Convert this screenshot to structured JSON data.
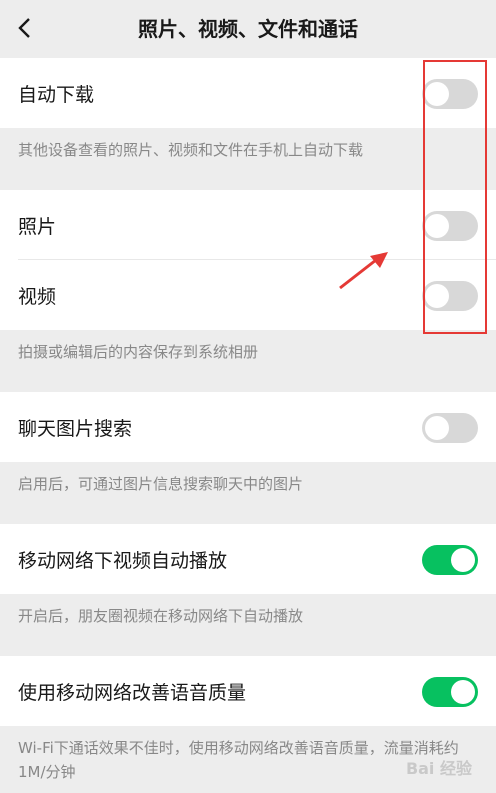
{
  "header": {
    "back_icon": "chevron-left-icon",
    "title": "照片、视频、文件和通话"
  },
  "settings": [
    {
      "label": "自动下载",
      "on": false
    },
    {
      "note": "其他设备查看的照片、视频和文件在手机上自动下载"
    },
    {
      "label": "照片",
      "on": false
    },
    {
      "label": "视频",
      "on": false
    },
    {
      "note": "拍摄或编辑后的内容保存到系统相册"
    },
    {
      "label": "聊天图片搜索",
      "on": false
    },
    {
      "note": "启用后，可通过图片信息搜索聊天中的图片"
    },
    {
      "label": "移动网络下视频自动播放",
      "on": true
    },
    {
      "note": "开启后，朋友圈视频在移动网络下自动播放"
    },
    {
      "label": "使用移动网络改善语音质量",
      "on": true
    },
    {
      "note": "Wi-Fi下通话效果不佳时，使用移动网络改善语音质量，流量消耗约1M/分钟"
    }
  ],
  "colors": {
    "toggle_on": "#07c160",
    "toggle_off": "#d8d8d8",
    "annotation": "#e53935"
  },
  "watermark": "Bai 经验"
}
